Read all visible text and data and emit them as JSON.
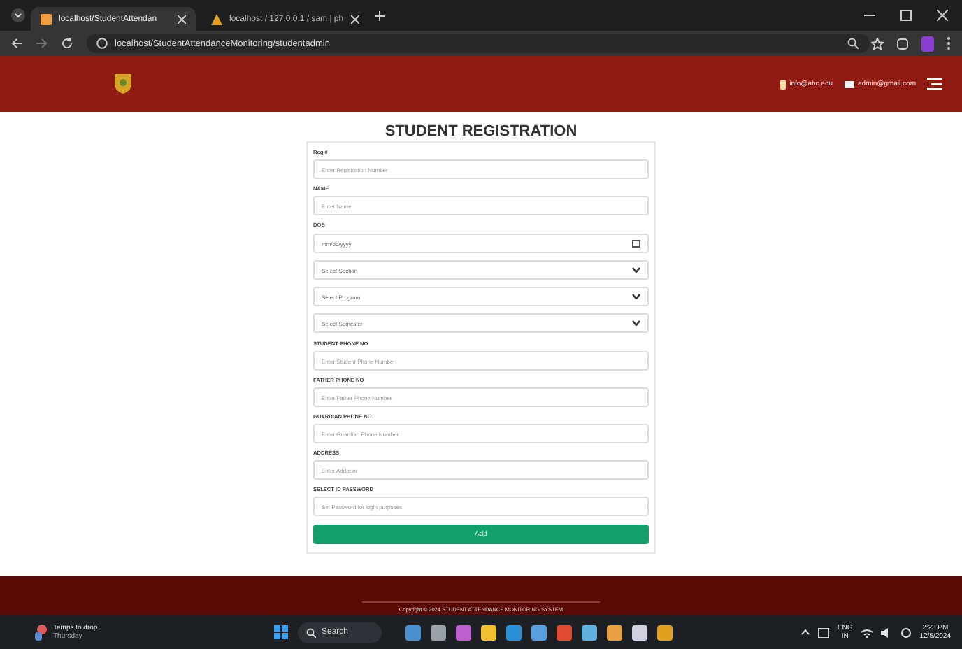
{
  "browser": {
    "tabs": [
      {
        "title": "localhost/StudentAttendan",
        "selected": true
      },
      {
        "title": "localhost / 127.0.0.1 / sam | ph",
        "selected": false
      }
    ],
    "url": "localhost/StudentAttendanceMonitoring/studentadmin"
  },
  "header": {
    "contacts": [
      "info@abc.edu",
      "admin@gmail.com"
    ]
  },
  "form": {
    "title": "STUDENT REGISTRATION",
    "fields": [
      {
        "kind": "input",
        "label": "Reg #",
        "placeholder": "Enter Registration Number"
      },
      {
        "kind": "input",
        "label": "NAME",
        "placeholder": "Enter Name"
      },
      {
        "kind": "date",
        "label": "DOB",
        "placeholder": "mm/dd/yyyy"
      },
      {
        "kind": "select",
        "placeholder": "Select Section"
      },
      {
        "kind": "select",
        "placeholder": "Select Program"
      },
      {
        "kind": "select",
        "placeholder": "Select Semester"
      },
      {
        "kind": "input",
        "label": "STUDENT PHONE NO",
        "placeholder": "Enter Student Phone Number"
      },
      {
        "kind": "input",
        "label": "FATHER PHONE NO",
        "placeholder": "Enter Father Phone Number"
      },
      {
        "kind": "input",
        "label": "GUARDIAN PHONE NO",
        "placeholder": "Enter Guardian Phone Number"
      },
      {
        "kind": "input",
        "label": "ADDRESS",
        "placeholder": "Enter Address"
      },
      {
        "kind": "input",
        "label": "SELECT ID PASSWORD",
        "placeholder": "Set Password for login purposes"
      }
    ],
    "submit": "Add"
  },
  "footer": {
    "text": "Copyright © 2024 STUDENT ATTENDANCE MONITORING SYSTEM"
  },
  "taskbar": {
    "weather": "Temps to drop",
    "day": "Thursday",
    "search": "Search",
    "lang": "ENG",
    "region": "IN",
    "time": "2:23 PM",
    "date": "12/5/2024"
  }
}
